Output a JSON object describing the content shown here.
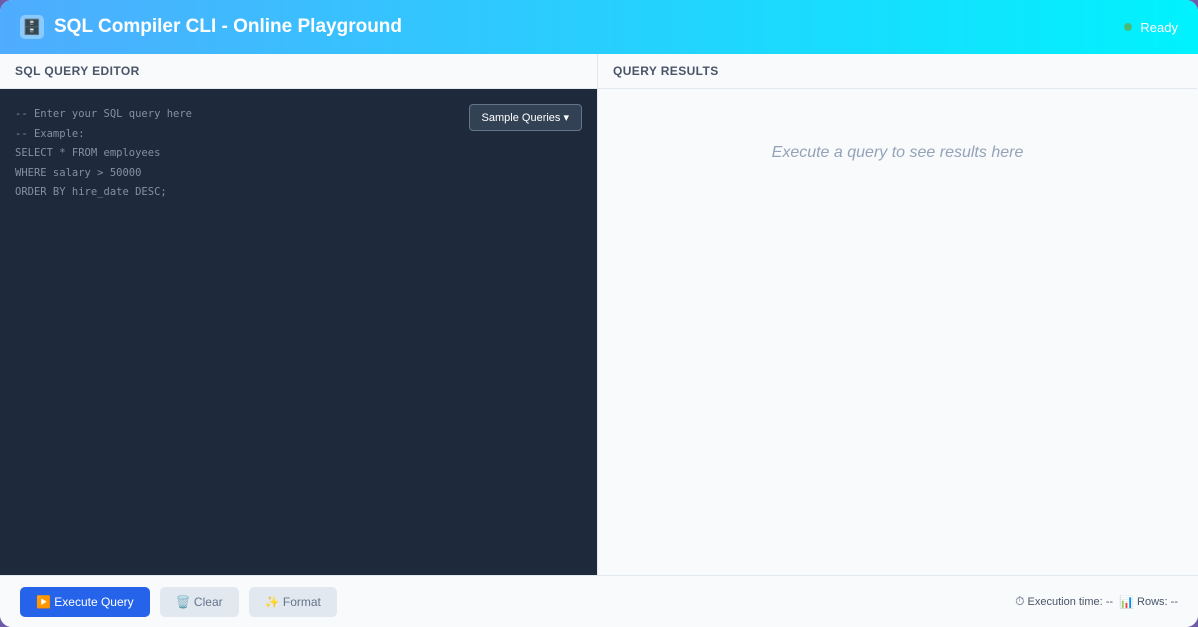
{
  "header": {
    "icon": "database-icon",
    "icon_glyph": "🗄️",
    "title": "SQL Compiler CLI - Online Playground",
    "status": "Ready"
  },
  "editor": {
    "title": "SQL QUERY EDITOR",
    "placeholder": "-- Enter your SQL query here\n-- Example:\nSELECT * FROM employees\nWHERE salary > 50000\nORDER BY hire_date DESC;",
    "sample_button": "Sample Queries ▾"
  },
  "results": {
    "title": "QUERY RESULTS",
    "empty_message": "Execute a query to see results here"
  },
  "toolbar": {
    "execute": "▶️ Execute Query",
    "clear": "🗑️ Clear",
    "format": "✨ Format"
  },
  "stats": {
    "execution_icon": "⏱",
    "execution_label": "Execution time: --",
    "rows_icon": "📊",
    "rows_label": "Rows: --"
  },
  "colors": {
    "header_gradient_start": "#4facfe",
    "header_gradient_end": "#00f2fe",
    "status_dot": "#48bb78",
    "editor_bg": "#1e293b",
    "primary_button": "#2563eb"
  }
}
